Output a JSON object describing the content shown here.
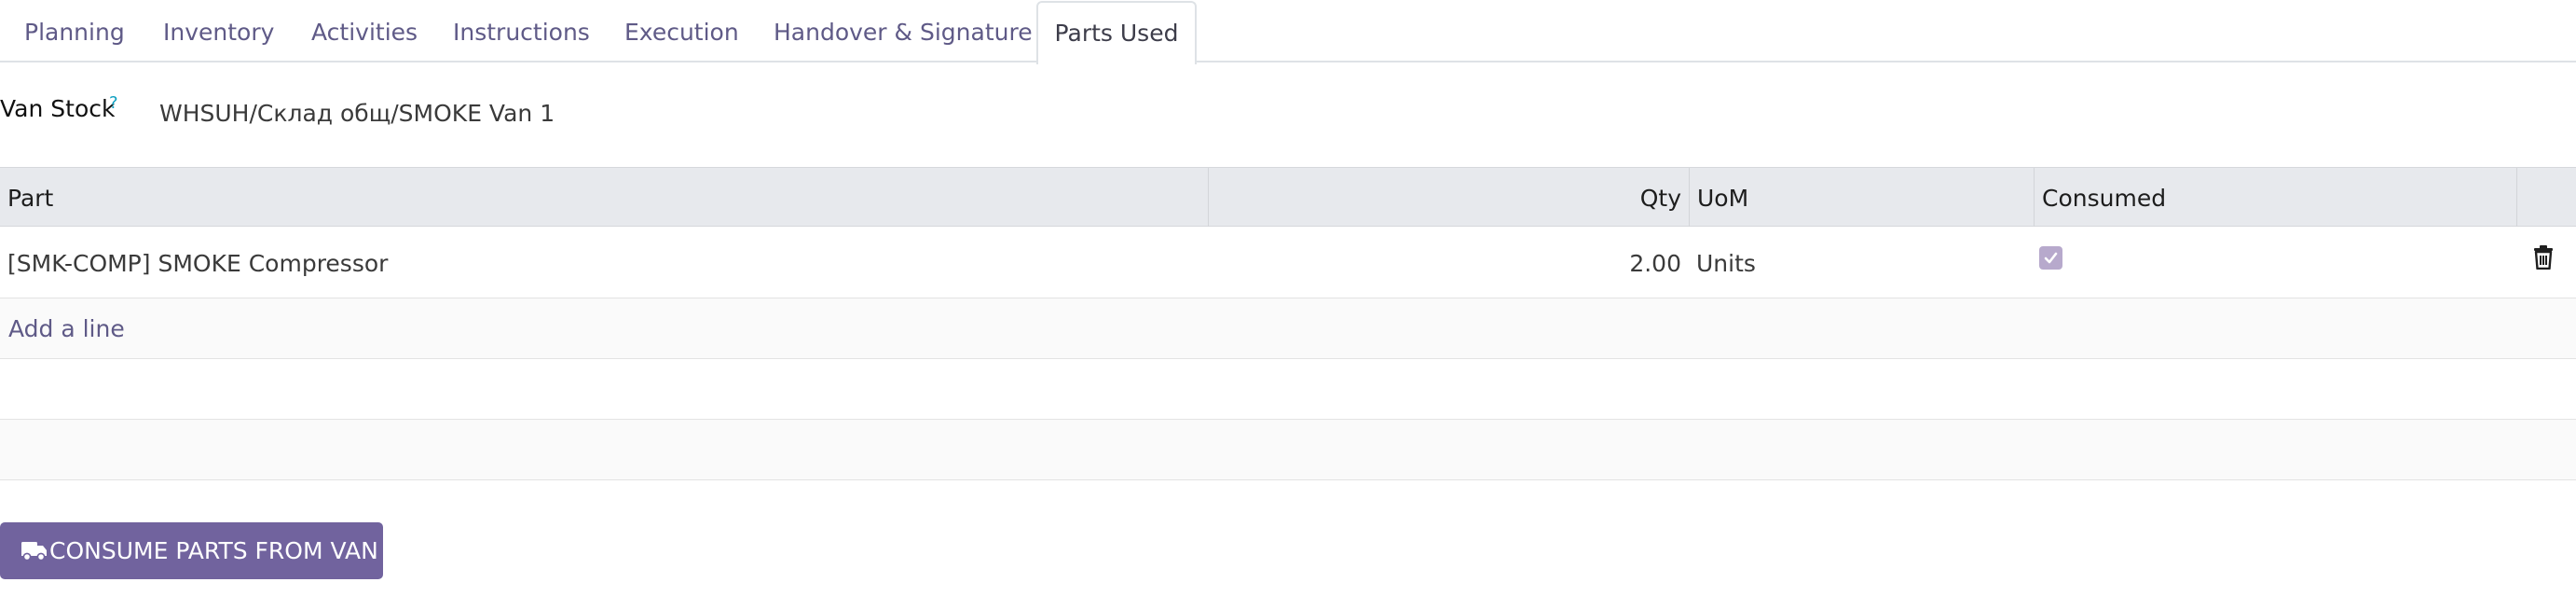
{
  "tabs": [
    {
      "label": "Planning"
    },
    {
      "label": "Inventory"
    },
    {
      "label": "Activities"
    },
    {
      "label": "Instructions"
    },
    {
      "label": "Execution"
    },
    {
      "label": "Handover & Signature"
    },
    {
      "label": "Parts Used",
      "active": true
    }
  ],
  "van_stock": {
    "label": "Van Stock",
    "help": "?",
    "value": "WHSUH/Склад общ/SMOKE Van 1"
  },
  "parts_table": {
    "columns": {
      "part": "Part",
      "qty": "Qty",
      "uom": "UoM",
      "consumed": "Consumed"
    },
    "rows": [
      {
        "part": "[SMK-COMP] SMOKE Compressor",
        "qty": "2.00",
        "uom": "Units",
        "consumed": true
      }
    ],
    "add_line": "Add a line"
  },
  "actions": {
    "consume_label": "CONSUME PARTS FROM VAN",
    "consume_icon": "truck-icon"
  },
  "colors": {
    "accent": "#71639e",
    "link": "#5f5a87",
    "checkbox": "#b7a9cc",
    "help": "#0d9fc0"
  }
}
